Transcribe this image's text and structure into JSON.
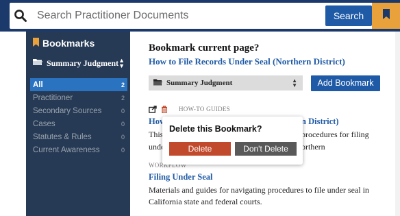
{
  "search": {
    "placeholder": "Search Practitioner Documents",
    "button_label": "Search"
  },
  "sidebar": {
    "heading": "Bookmarks",
    "folder": "Summary Judgment",
    "items": [
      {
        "label": "All",
        "count": "2",
        "active": true
      },
      {
        "label": "Practitioner",
        "count": "2",
        "active": false
      },
      {
        "label": "Secondary Sources",
        "count": "0",
        "active": false
      },
      {
        "label": "Cases",
        "count": "0",
        "active": false
      },
      {
        "label": "Statutes & Rules",
        "count": "0",
        "active": false
      },
      {
        "label": "Current Awareness",
        "count": "0",
        "active": false
      }
    ]
  },
  "panel": {
    "title": "Bookmark current page?",
    "page_link": "How to File Records Under Seal (Northern District)",
    "folder_select": "Summary Judgment",
    "add_button": "Add Bookmark",
    "bookmarks": [
      {
        "category": "HOW-TO GUIDES",
        "title_start": "How",
        "title_end": "n District)",
        "desc_line1_start": "This",
        "desc_line1_end": "procedures for filing",
        "desc_line2_start": "unde",
        "desc_line2_end": "orthern"
      },
      {
        "category": "WORKFLOW",
        "title": "Filing Under Seal",
        "desc_line1": "Materials and guides for navigating procedures to file under seal in",
        "desc_line2": "California state and federal courts."
      }
    ]
  },
  "popup": {
    "title": "Delete this Bookmark?",
    "delete_label": "Delete",
    "keep_label": "Don't Delete"
  },
  "colors": {
    "navy": "#1b3a6b",
    "sidebar": "#263a55",
    "accent_blue": "#1f5aa6",
    "bookmark_orange": "#e9a13b",
    "delete_red": "#c24a2c",
    "cancel_gray": "#595959"
  },
  "icons": [
    "search-icon",
    "bookmark-icon",
    "folder-icon",
    "sort-icon",
    "share-icon",
    "trash-icon"
  ]
}
